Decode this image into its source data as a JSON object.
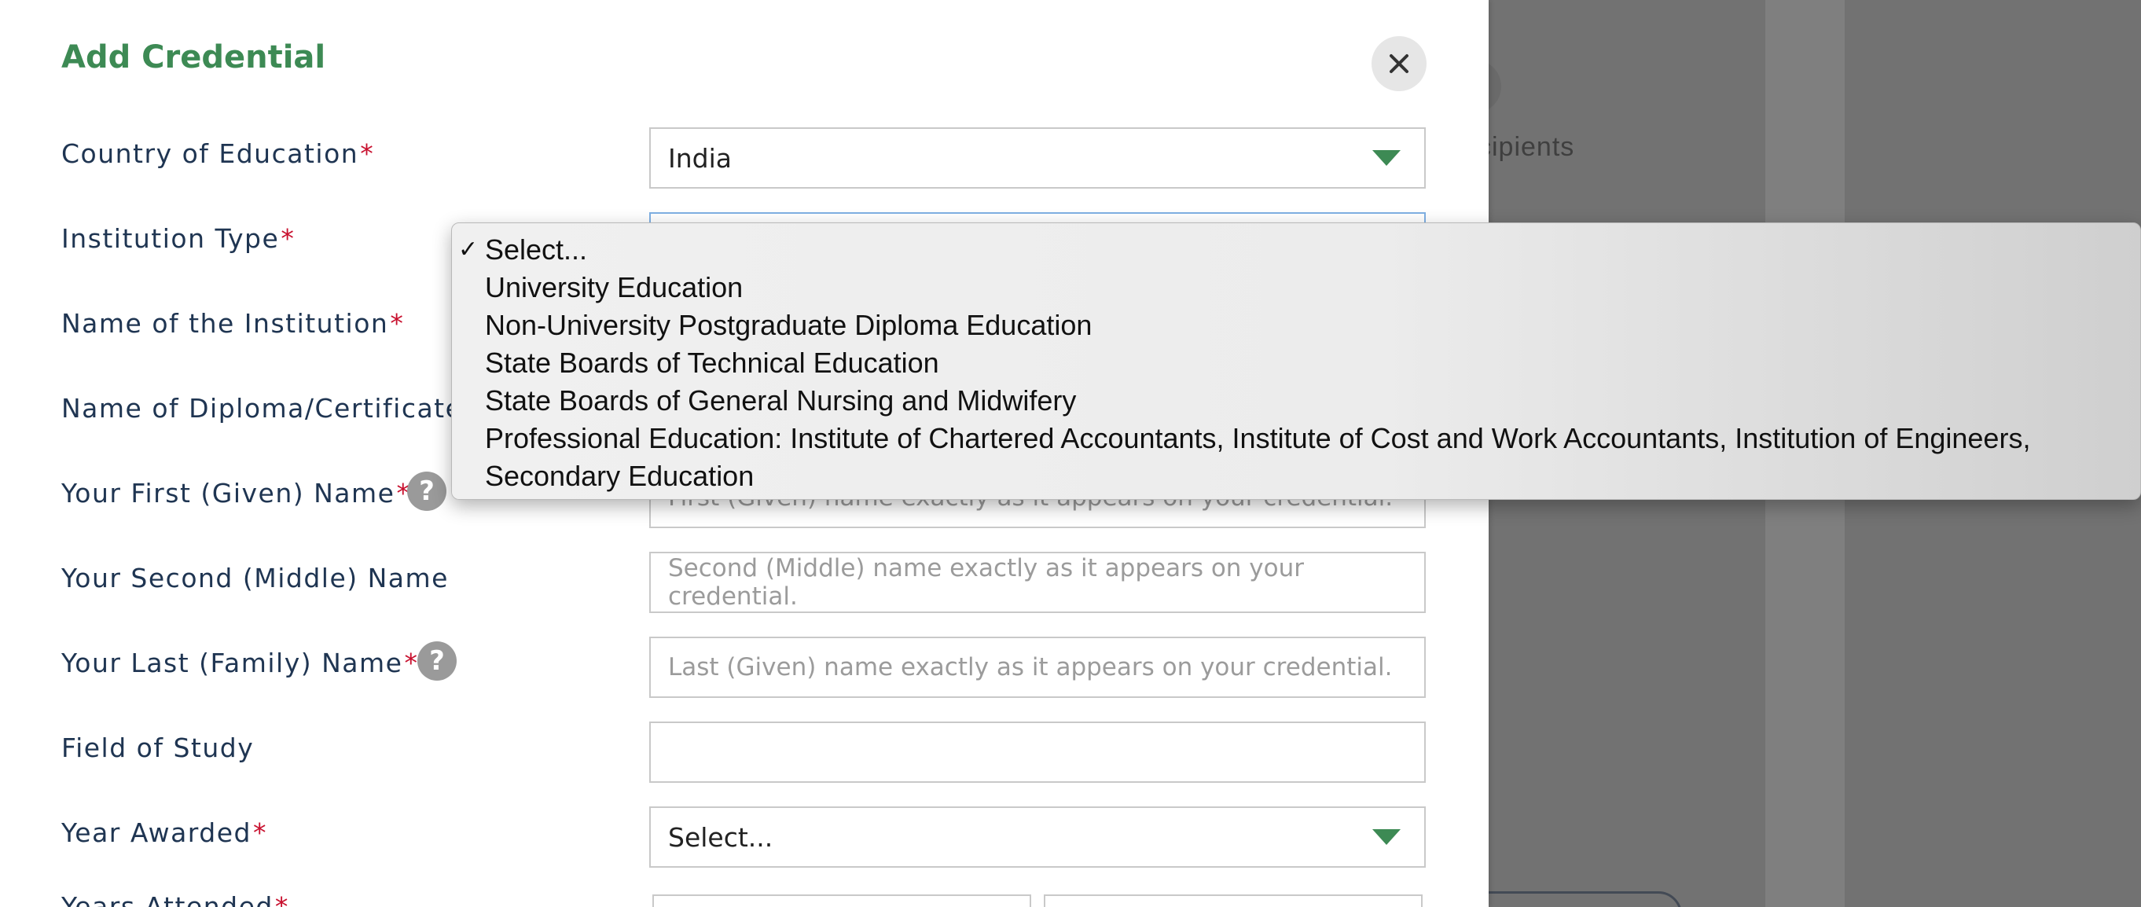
{
  "background": {
    "partial_text": "cipients"
  },
  "modal": {
    "title": "Add Credential",
    "close_icon": "close-icon",
    "required_marker": "*",
    "help_icon_glyph": "?"
  },
  "fields": {
    "country": {
      "label": "Country of Education",
      "value": "India"
    },
    "institution_type": {
      "label": "Institution Type"
    },
    "institution_name": {
      "label": "Name of the Institution"
    },
    "diploma_name": {
      "label": "Name of Diploma/Certificate"
    },
    "first_name": {
      "label": "Your First (Given) Name",
      "placeholder": "First (Given) name exactly as it appears on your credential."
    },
    "middle_name": {
      "label": "Your Second (Middle) Name",
      "placeholder": "Second (Middle) name exactly as it appears on your credential."
    },
    "last_name": {
      "label": "Your Last (Family) Name",
      "placeholder": "Last (Given) name exactly as it appears on your credential."
    },
    "field_of_study": {
      "label": "Field of Study"
    },
    "year_awarded": {
      "label": "Year Awarded",
      "value": "Select..."
    },
    "years_attended": {
      "label": "Years Attended"
    }
  },
  "dropdown": {
    "check_glyph": "✓",
    "options": [
      "Select...",
      "University Education",
      "Non-University Postgraduate Diploma Education",
      "State Boards of Technical Education",
      "State Boards of General Nursing and Midwifery",
      "Professional Education: Institute of Chartered Accountants, Institute of Cost and Work Accountants, Institution of Engineers,",
      "Secondary Education"
    ]
  },
  "colors": {
    "brand_green": "#3d8a54",
    "label_navy": "#1f3552",
    "required_red": "#c8102e",
    "focus_blue": "#7fb0e3"
  }
}
